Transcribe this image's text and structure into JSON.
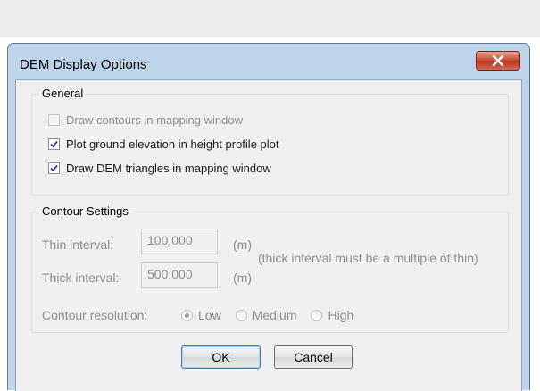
{
  "dialog": {
    "title": "DEM Display Options",
    "close_icon": "close-icon (X)"
  },
  "general": {
    "title": "General",
    "options": [
      {
        "label": "Draw contours in mapping window",
        "checked": false,
        "enabled": false
      },
      {
        "label": "Plot ground elevation in height profile plot",
        "checked": true,
        "enabled": true
      },
      {
        "label": "Draw DEM triangles in mapping window",
        "checked": true,
        "enabled": true
      }
    ]
  },
  "contour": {
    "title": "Contour Settings",
    "thin_label": "Thin interval:",
    "thin_value": "100.000",
    "thick_label": "Thick interval:",
    "thick_value": "500.000",
    "unit": "(m)",
    "hint": "(thick interval must be a multiple of thin)",
    "resolution_label": "Contour resolution:",
    "resolution_options": [
      "Low",
      "Medium",
      "High"
    ],
    "resolution_selected": "Low"
  },
  "buttons": {
    "ok": "OK",
    "cancel": "Cancel"
  }
}
